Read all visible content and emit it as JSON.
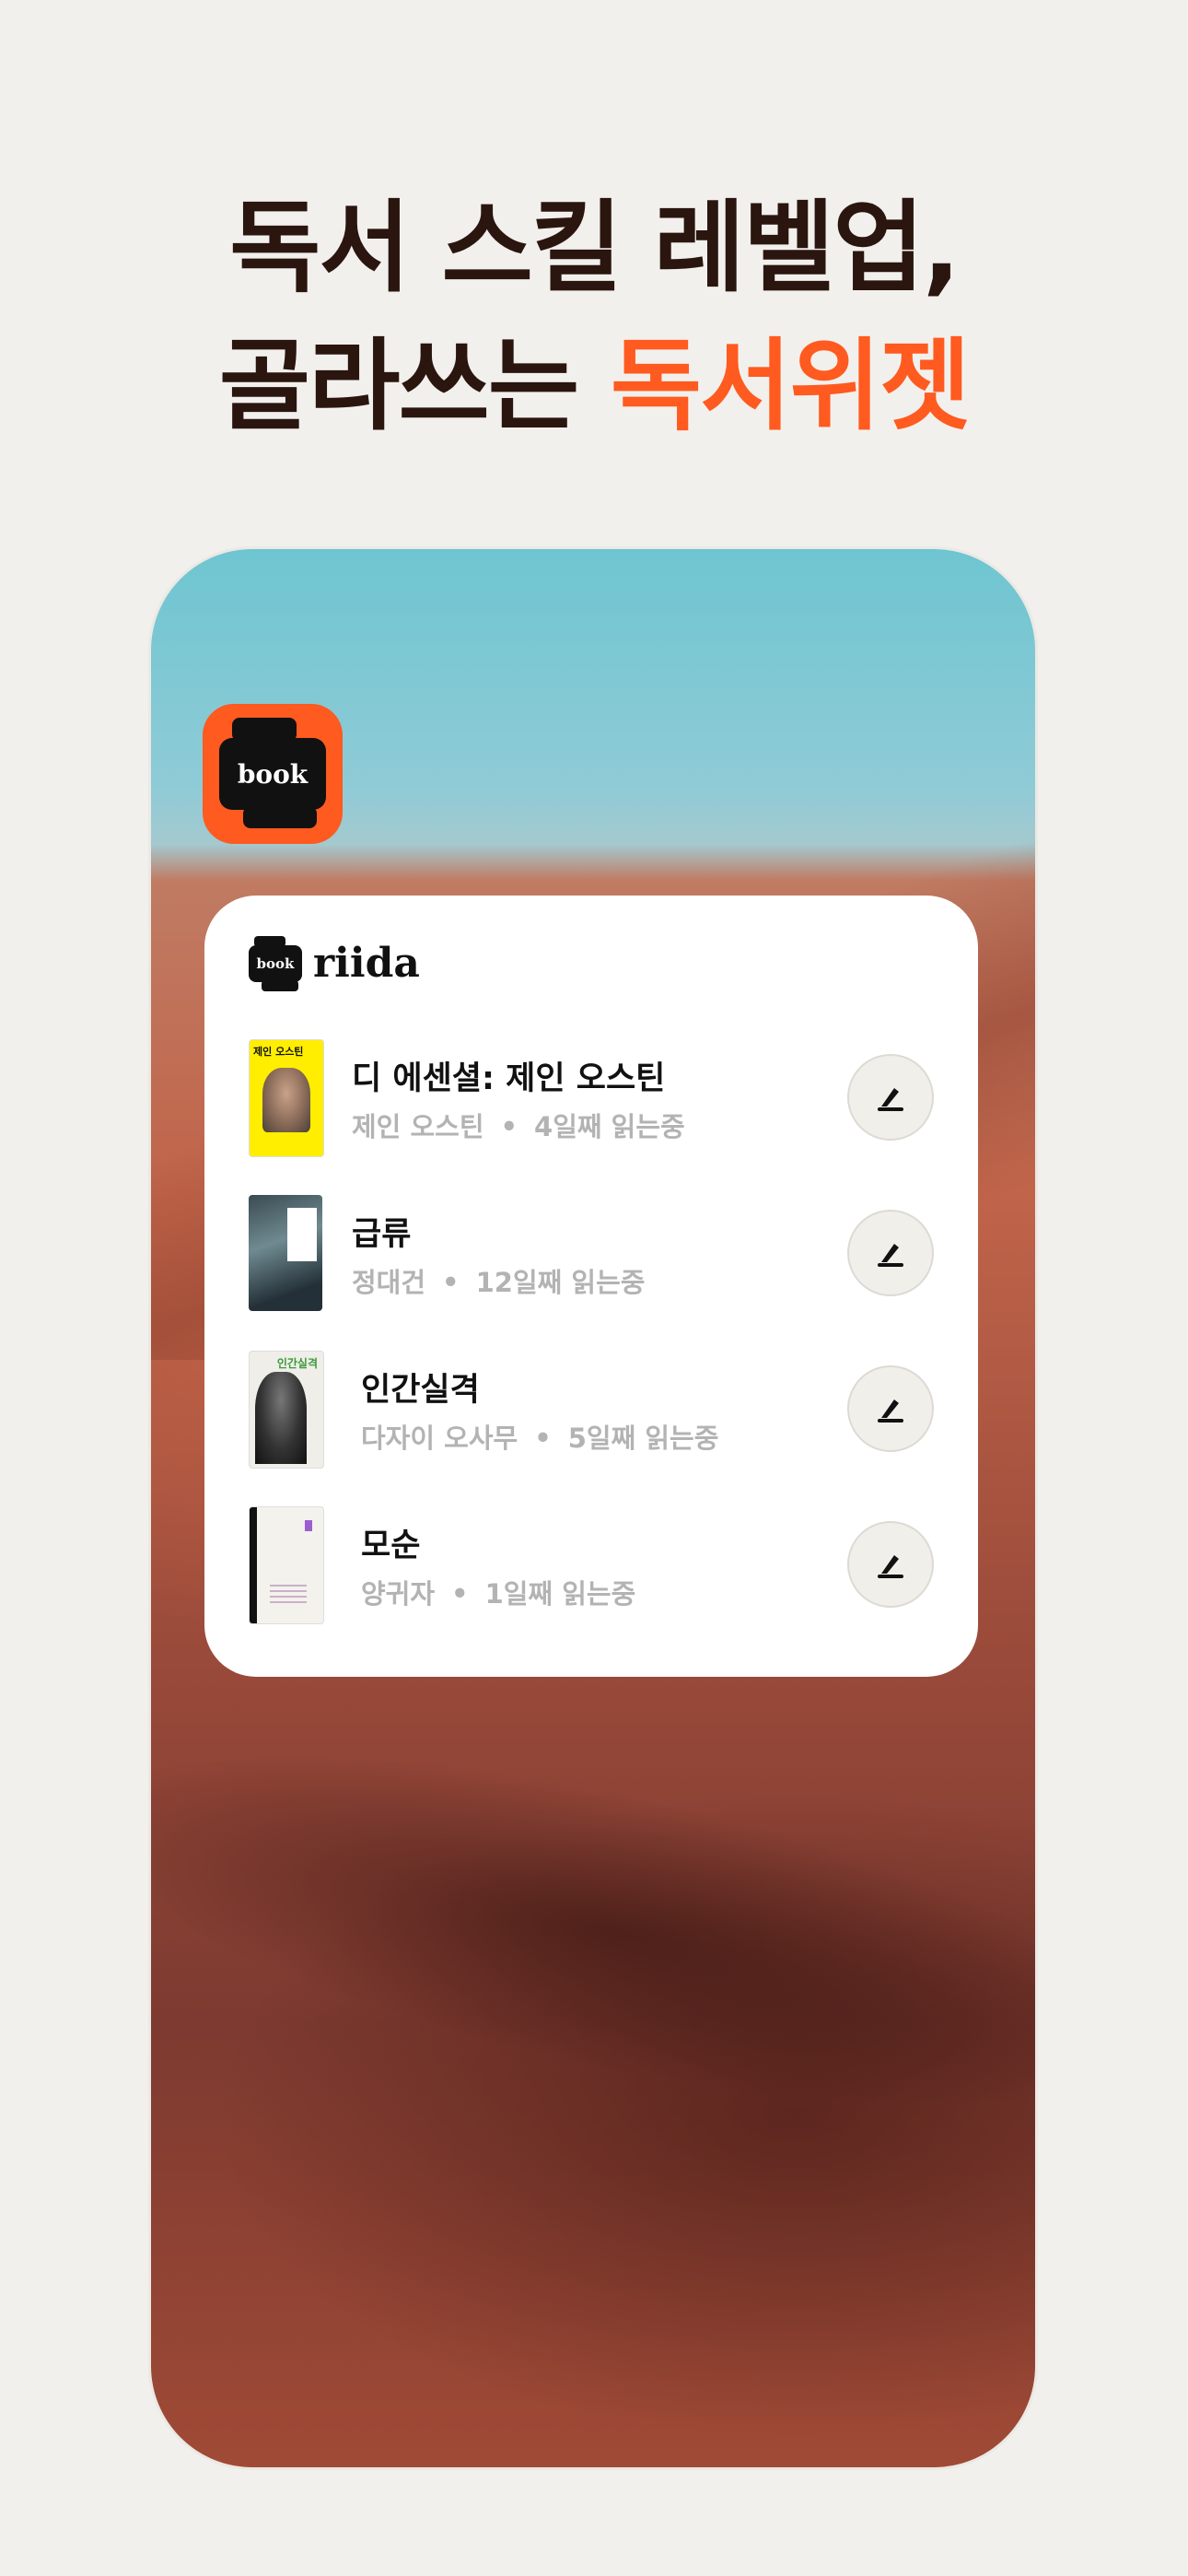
{
  "headline": {
    "line1": "독서 스킬 레벨업,",
    "line2_prefix": "골라쓰는 ",
    "line2_accent": "독서위젯"
  },
  "app_icon": {
    "label": "book"
  },
  "widget": {
    "logo_label": "book",
    "brand_name": "riida",
    "books": [
      {
        "title": "디 에센셜: 제인 오스틴",
        "author": "제인 오스틴",
        "dot": "•",
        "progress": "4일째 읽는중",
        "cover_text": "제인 오스틴"
      },
      {
        "title": "급류",
        "author": "정대건",
        "dot": "•",
        "progress": "12일째 읽는중"
      },
      {
        "title": "인간실격",
        "author": "다자이 오사무",
        "dot": "•",
        "progress": "5일째 읽는중",
        "cover_text": "인간실격"
      },
      {
        "title": "모순",
        "author": "양귀자",
        "dot": "•",
        "progress": "1일째 읽는중"
      }
    ]
  },
  "colors": {
    "accent": "#ff5a1f",
    "headline": "#2a150f",
    "meta_text": "#b3b3b3"
  },
  "icons": {
    "write_button": "pen-icon"
  }
}
